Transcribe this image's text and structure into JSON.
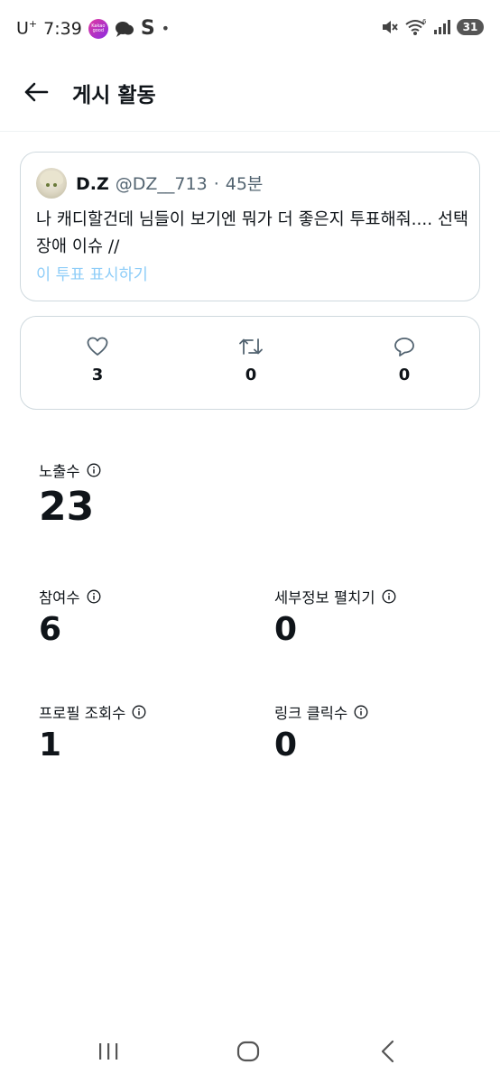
{
  "status_bar": {
    "carrier": "U",
    "carrier_sup": "+",
    "time": "7:39",
    "app_icon_text": "Kakao good",
    "dot": "•",
    "battery": "31",
    "icons": [
      "kakao-app-icon",
      "chat-bubble-icon",
      "s-icon",
      "mute-icon",
      "wifi-icon",
      "signal-icon",
      "battery-icon"
    ]
  },
  "header": {
    "title": "게시 활동",
    "back_icon": "arrow-left-icon"
  },
  "tweet": {
    "name": "D.Z",
    "handle": "@DZ__713",
    "separator": "·",
    "time": "45분",
    "text": "나 캐디할건데 님들이 보기엔 뭐가 더 좋은지 투표해줘.... 선택장애 이슈 //",
    "poll_link": "이 투표 표시하기"
  },
  "engagement": {
    "likes": "3",
    "retweets": "0",
    "replies": "0",
    "icons": [
      "heart-icon",
      "retweet-icon",
      "reply-icon"
    ]
  },
  "metrics": {
    "impressions": {
      "label": "노출수",
      "value": "23"
    },
    "engagements": {
      "label": "참여수",
      "value": "6"
    },
    "detail_expands": {
      "label": "세부정보 펼치기",
      "value": "0"
    },
    "profile_visits": {
      "label": "프로필 조회수",
      "value": "1"
    },
    "link_clicks": {
      "label": "링크 클릭수",
      "value": "0"
    }
  },
  "colors": {
    "text": "#0f1419",
    "secondary": "#536471",
    "link": "#8ecdf8",
    "border": "#cfd9de"
  },
  "nav": {
    "icons": [
      "recent-apps-icon",
      "home-icon",
      "back-icon"
    ]
  }
}
